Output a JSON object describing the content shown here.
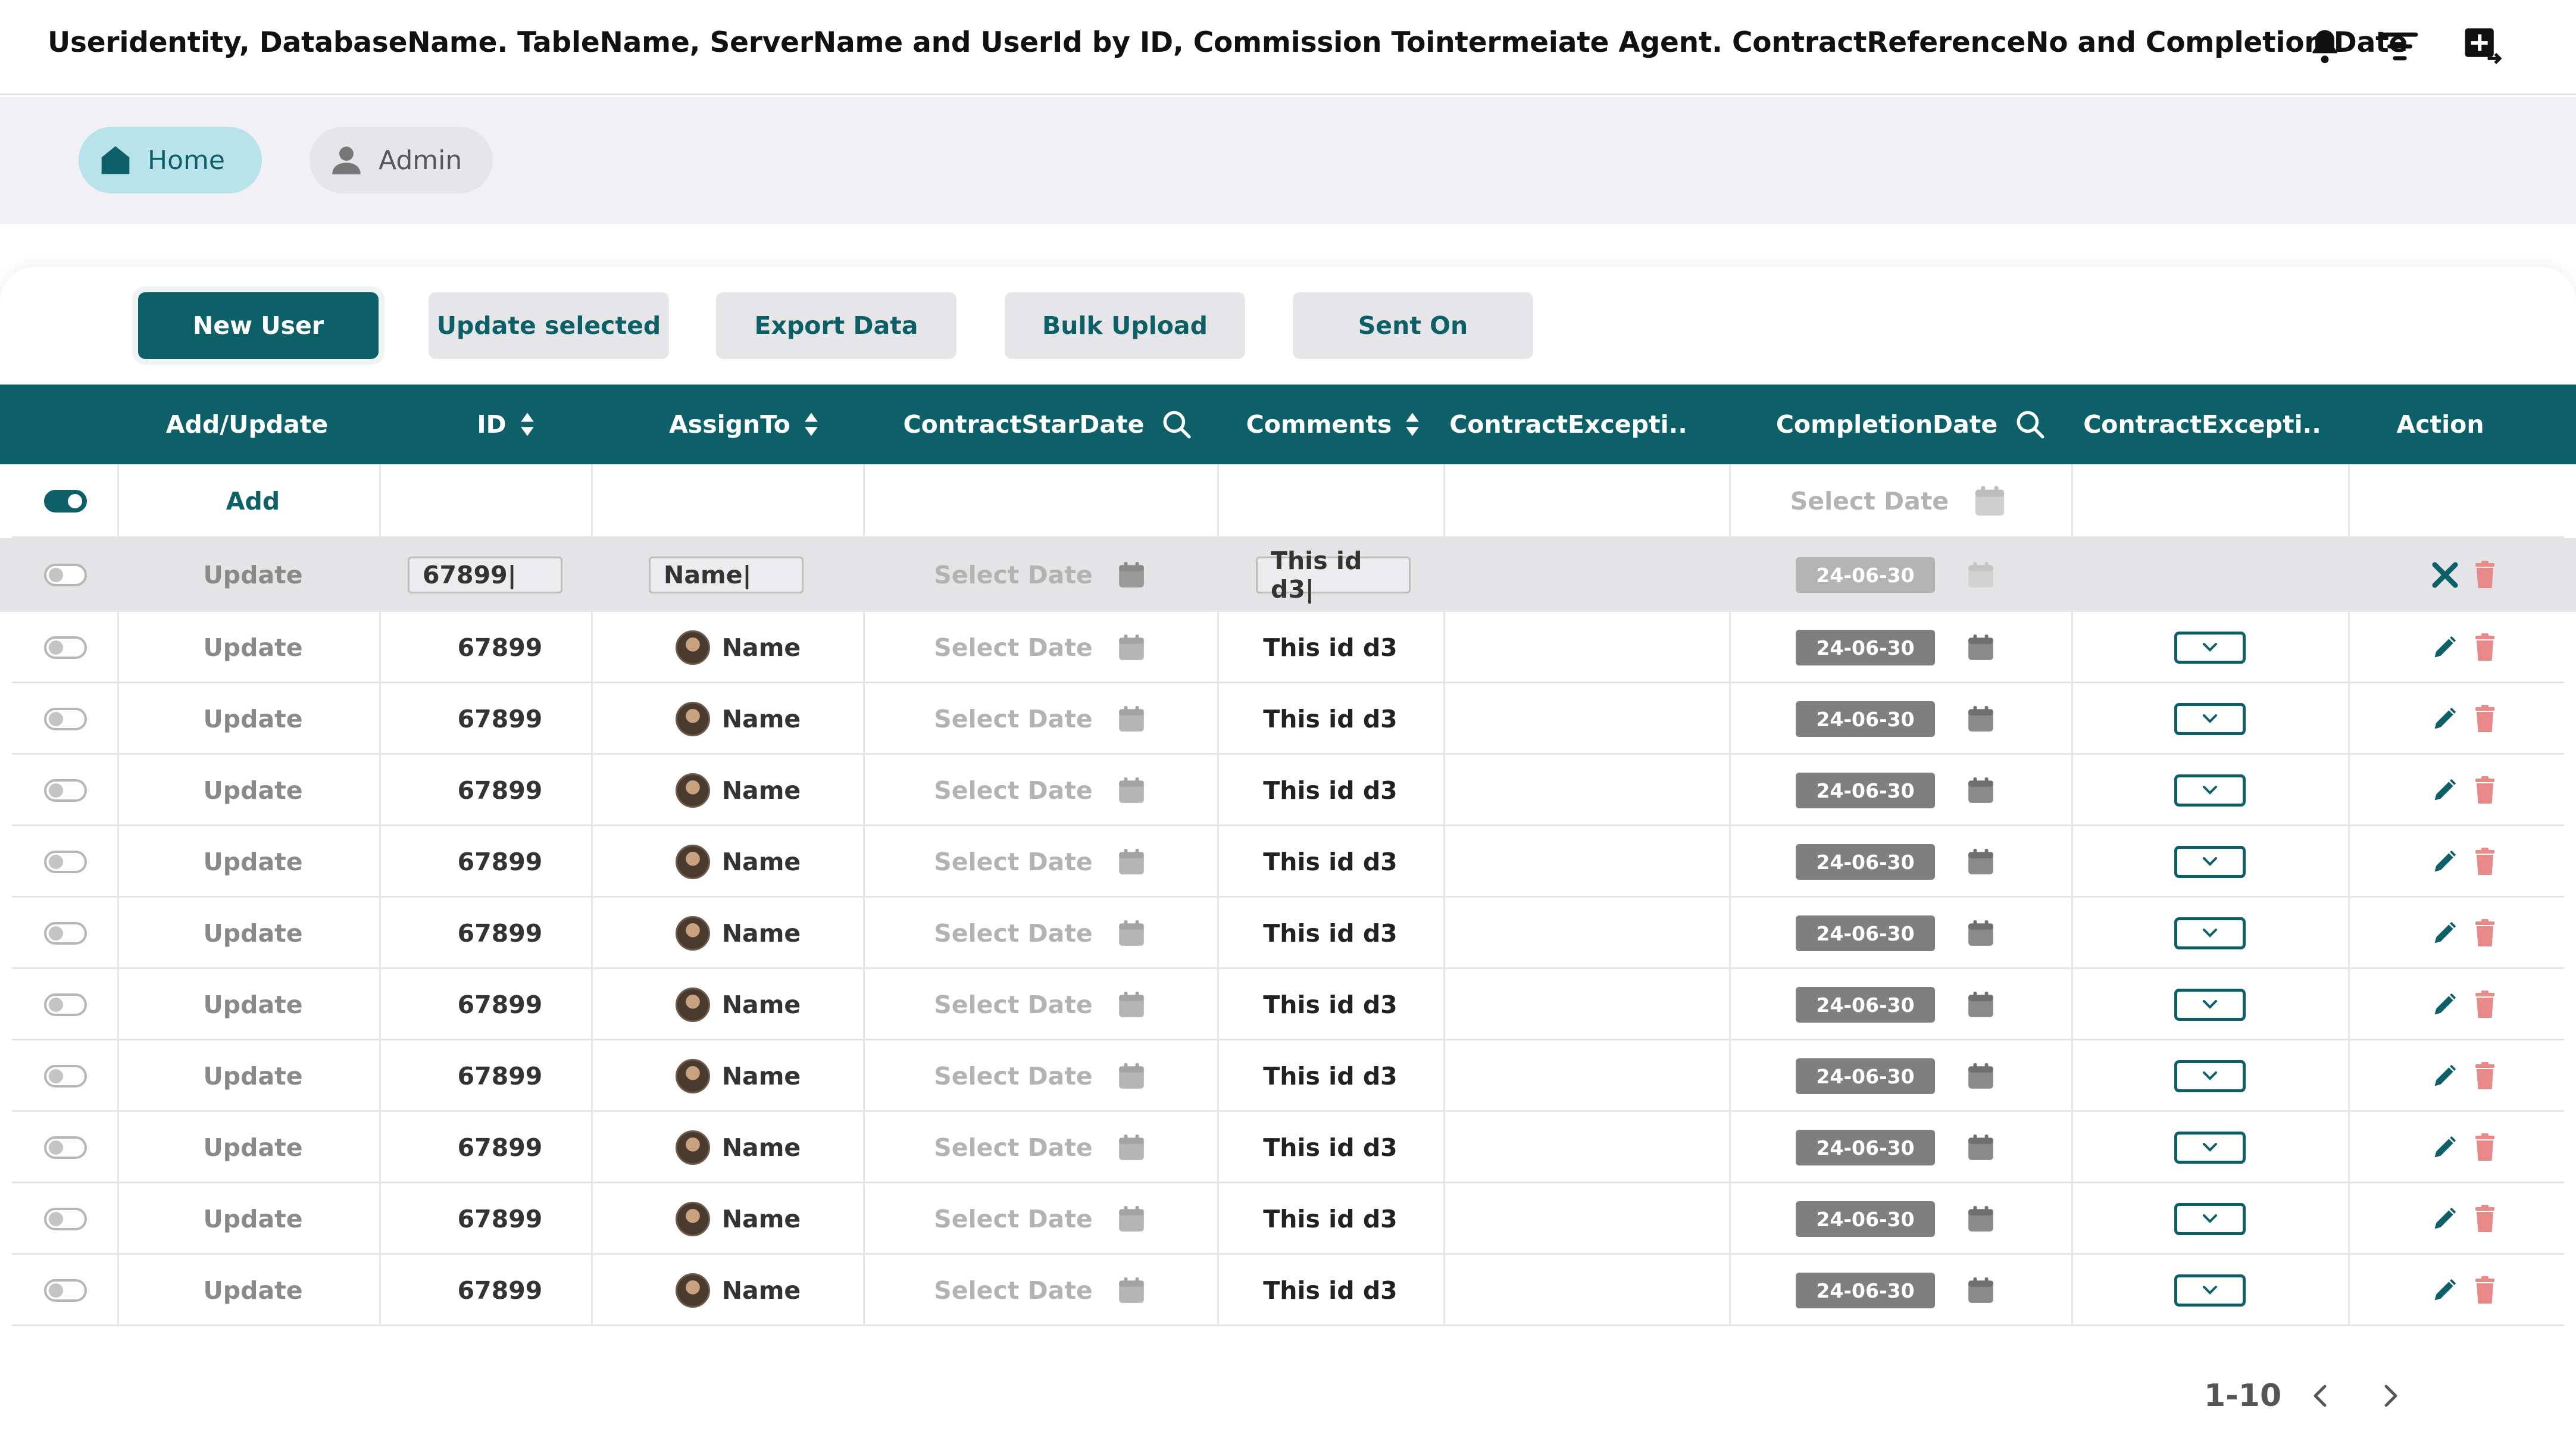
{
  "header": {
    "title": "Useridentity, DatabaseName. TableName, ServerName and UserId by ID, Commission Tointermeiate Agent. ContractReferenceNo and Completion Date",
    "icons": [
      "bell-icon",
      "menu-lines-icon",
      "export-file-icon"
    ]
  },
  "nav": {
    "home_label": "Home",
    "admin_label": "Admin"
  },
  "toolbar": {
    "new_user": "New User",
    "update_selected": "Update selected",
    "export_data": "Export Data",
    "bulk_upload": "Bulk Upload",
    "sent_on": "Sent On"
  },
  "table": {
    "columns": {
      "add_update": "Add/Update",
      "id": "ID",
      "assign_to": "AssignTo",
      "contract_start_date": "ContractStarDate",
      "comments": "Comments",
      "contract_exception_1": "ContractExcepti..",
      "completion_date": "CompletionDate",
      "contract_exception_2": "ContractExcepti..",
      "action": "Action"
    },
    "add_row": {
      "label": "Add",
      "completion_placeholder": "Select Date",
      "toggle_on": true
    },
    "edit_row": {
      "label": "Update",
      "id_value": "67899|",
      "name_value": "Name|",
      "start_placeholder": "Select Date",
      "comment_value": "This id d3|",
      "completion_value": "24-06-30"
    },
    "rows": [
      {
        "label": "Update",
        "id": "67899",
        "name": "Name",
        "start": "Select Date",
        "comment": "This id d3",
        "completion": "24-06-30"
      },
      {
        "label": "Update",
        "id": "67899",
        "name": "Name",
        "start": "Select Date",
        "comment": "This id d3",
        "completion": "24-06-30"
      },
      {
        "label": "Update",
        "id": "67899",
        "name": "Name",
        "start": "Select Date",
        "comment": "This id d3",
        "completion": "24-06-30"
      },
      {
        "label": "Update",
        "id": "67899",
        "name": "Name",
        "start": "Select Date",
        "comment": "This id d3",
        "completion": "24-06-30"
      },
      {
        "label": "Update",
        "id": "67899",
        "name": "Name",
        "start": "Select Date",
        "comment": "This id d3",
        "completion": "24-06-30"
      },
      {
        "label": "Update",
        "id": "67899",
        "name": "Name",
        "start": "Select Date",
        "comment": "This id d3",
        "completion": "24-06-30"
      },
      {
        "label": "Update",
        "id": "67899",
        "name": "Name",
        "start": "Select Date",
        "comment": "This id d3",
        "completion": "24-06-30"
      },
      {
        "label": "Update",
        "id": "67899",
        "name": "Name",
        "start": "Select Date",
        "comment": "This id d3",
        "completion": "24-06-30"
      },
      {
        "label": "Update",
        "id": "67899",
        "name": "Name",
        "start": "Select Date",
        "comment": "This id d3",
        "completion": "24-06-30"
      },
      {
        "label": "Update",
        "id": "67899",
        "name": "Name",
        "start": "Select Date",
        "comment": "This id d3",
        "completion": "24-06-30"
      }
    ]
  },
  "pagination": {
    "range": "1-10"
  },
  "colors": {
    "primary": "#0d6068",
    "nav_home_bg": "#b9e3ea",
    "danger": "#e88a8a",
    "badge": "#7f7f7f"
  }
}
